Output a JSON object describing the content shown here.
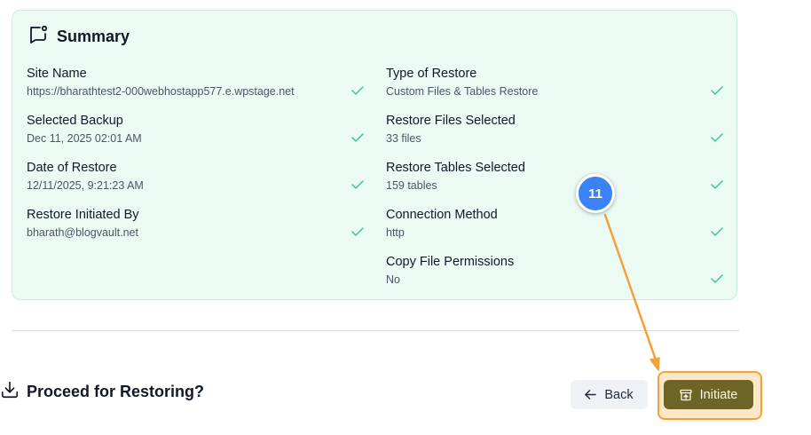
{
  "summary": {
    "title": "Summary",
    "icon": "chat-bubble-icon",
    "fields": [
      {
        "label": "Site Name",
        "value": "https://bharathtest2-000webhostapp577.e.wpstage.net"
      },
      {
        "label": "Selected Backup",
        "value": "Dec 11, 2025 02:01 AM"
      },
      {
        "label": "Date of Restore",
        "value": "12/11/2025, 9:21:23 AM"
      },
      {
        "label": "Restore Initiated By",
        "value": "bharath@blogvault.net"
      },
      {
        "label": "Type of Restore",
        "value": "Custom Files & Tables Restore"
      },
      {
        "label": "Restore Files Selected",
        "value": "33 files"
      },
      {
        "label": "Restore Tables Selected",
        "value": "159 tables"
      },
      {
        "label": "Connection Method",
        "value": "http"
      },
      {
        "label": "Copy File Permissions",
        "value": "No"
      }
    ],
    "check_icon": "checkmark-icon",
    "check_color": "#3cc78f"
  },
  "footer": {
    "proceed_label": "Proceed for Restoring?",
    "proceed_icon": "download-icon",
    "back_label": "Back",
    "back_icon": "arrow-left-icon",
    "initiate_label": "Initiate",
    "initiate_icon": "archive-restore-icon"
  },
  "annotation": {
    "step_number": "11",
    "badge_color": "#3b82f6",
    "arrow_color": "#f4a13a"
  },
  "colors": {
    "card_bg": "#ebfbf3",
    "card_border": "#c6eedb",
    "initiate_bg": "#6d6426",
    "highlight": "#f4a13a"
  }
}
